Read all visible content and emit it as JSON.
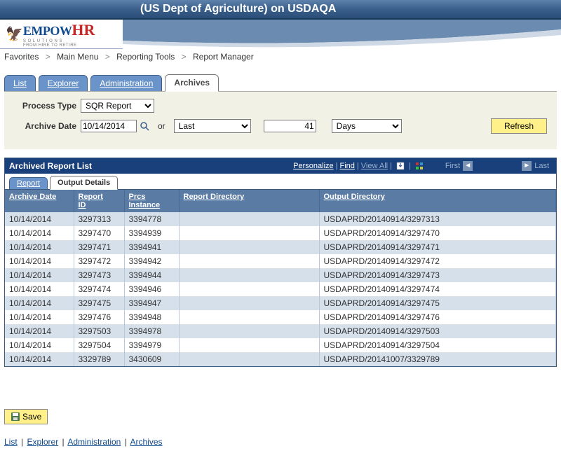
{
  "header": {
    "banner_text": "(US Dept of Agriculture) on USDAQA",
    "logo_line1a": "EMPOW",
    "logo_line1b": "HR",
    "logo_line2": "S O L U T I O N S",
    "logo_line3": "FROM HIRE TO RETIRE"
  },
  "breadcrumb": {
    "items": [
      "Favorites",
      "Main Menu",
      "Reporting Tools",
      "Report Manager"
    ]
  },
  "tabs": {
    "items": [
      "List",
      "Explorer",
      "Administration",
      "Archives"
    ],
    "active": "Archives"
  },
  "form": {
    "process_type_label": "Process Type",
    "process_type_value": "SQR Report",
    "archive_date_label": "Archive Date",
    "archive_date_value": "10/14/2014",
    "or_text": "or",
    "last_value": "Last",
    "count_value": "41",
    "unit_value": "Days",
    "refresh_label": "Refresh"
  },
  "grid": {
    "title": "Archived Report List",
    "actions": {
      "personalize": "Personalize",
      "find": "Find",
      "view_all": "View All",
      "first": "First",
      "last": "Last"
    },
    "inner_tabs": [
      "Report",
      "Output Details"
    ],
    "inner_active": "Output Details",
    "columns": [
      "Archive Date",
      "Report ID",
      "Prcs Instance",
      "Report Directory",
      "Output Directory"
    ],
    "rows": [
      {
        "archive_date": "10/14/2014",
        "report_id": "3297313",
        "prcs": "3394778",
        "rdir": "",
        "odir": "USDAPRD/20140914/3297313"
      },
      {
        "archive_date": "10/14/2014",
        "report_id": "3297470",
        "prcs": "3394939",
        "rdir": "",
        "odir": "USDAPRD/20140914/3297470"
      },
      {
        "archive_date": "10/14/2014",
        "report_id": "3297471",
        "prcs": "3394941",
        "rdir": "",
        "odir": "USDAPRD/20140914/3297471"
      },
      {
        "archive_date": "10/14/2014",
        "report_id": "3297472",
        "prcs": "3394942",
        "rdir": "",
        "odir": "USDAPRD/20140914/3297472"
      },
      {
        "archive_date": "10/14/2014",
        "report_id": "3297473",
        "prcs": "3394944",
        "rdir": "",
        "odir": "USDAPRD/20140914/3297473"
      },
      {
        "archive_date": "10/14/2014",
        "report_id": "3297474",
        "prcs": "3394946",
        "rdir": "",
        "odir": "USDAPRD/20140914/3297474"
      },
      {
        "archive_date": "10/14/2014",
        "report_id": "3297475",
        "prcs": "3394947",
        "rdir": "",
        "odir": "USDAPRD/20140914/3297475"
      },
      {
        "archive_date": "10/14/2014",
        "report_id": "3297476",
        "prcs": "3394948",
        "rdir": "",
        "odir": "USDAPRD/20140914/3297476"
      },
      {
        "archive_date": "10/14/2014",
        "report_id": "3297503",
        "prcs": "3394978",
        "rdir": "",
        "odir": "USDAPRD/20140914/3297503"
      },
      {
        "archive_date": "10/14/2014",
        "report_id": "3297504",
        "prcs": "3394979",
        "rdir": "",
        "odir": "USDAPRD/20140914/3297504"
      },
      {
        "archive_date": "10/14/2014",
        "report_id": "3329789",
        "prcs": "3430609",
        "rdir": "",
        "odir": "USDAPRD/20141007/3329789"
      }
    ]
  },
  "save": {
    "label": "Save"
  },
  "bottom_links": [
    "List",
    "Explorer",
    "Administration",
    "Archives"
  ]
}
